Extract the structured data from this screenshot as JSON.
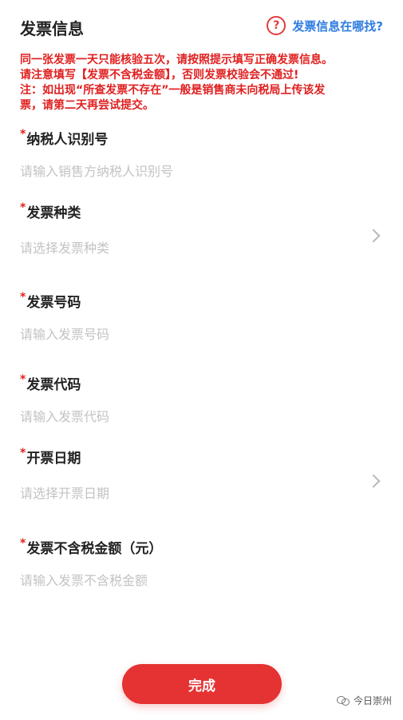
{
  "header": {
    "title": "发票信息",
    "help_icon": "?",
    "help_text": "发票信息在哪找?"
  },
  "notice": {
    "lines": [
      "同一张发票一天只能核验五次，请按照提示填写正确发票信息。",
      "请注意填写【发票不含税金额】，否则发票校验会不通过!",
      "注：如出现“所查发票不存在”一般是销售商未向税局上传该发",
      "票，请第二天再尝试提交。"
    ]
  },
  "required_mark": "*",
  "fields": {
    "taxpayer_id": {
      "label": "纳税人识别号",
      "placeholder": "请输入销售方纳税人识别号",
      "value": ""
    },
    "invoice_type": {
      "label": "发票种类",
      "placeholder": "请选择发票种类"
    },
    "invoice_number": {
      "label": "发票号码",
      "placeholder": "请输入发票号码",
      "value": ""
    },
    "invoice_code": {
      "label": "发票代码",
      "placeholder": "请输入发票代码",
      "value": ""
    },
    "invoice_date": {
      "label": "开票日期",
      "placeholder": "请选择开票日期"
    },
    "amount": {
      "label": "发票不含税金额（元）",
      "placeholder": "请输入发票不含税金额",
      "value": ""
    }
  },
  "submit_label": "完成",
  "watermark": "今日崇州",
  "colors": {
    "accent_red": "#e53232",
    "notice_red": "#e02020",
    "link_blue": "#2f7de1",
    "placeholder_gray": "#c3c3c3"
  }
}
